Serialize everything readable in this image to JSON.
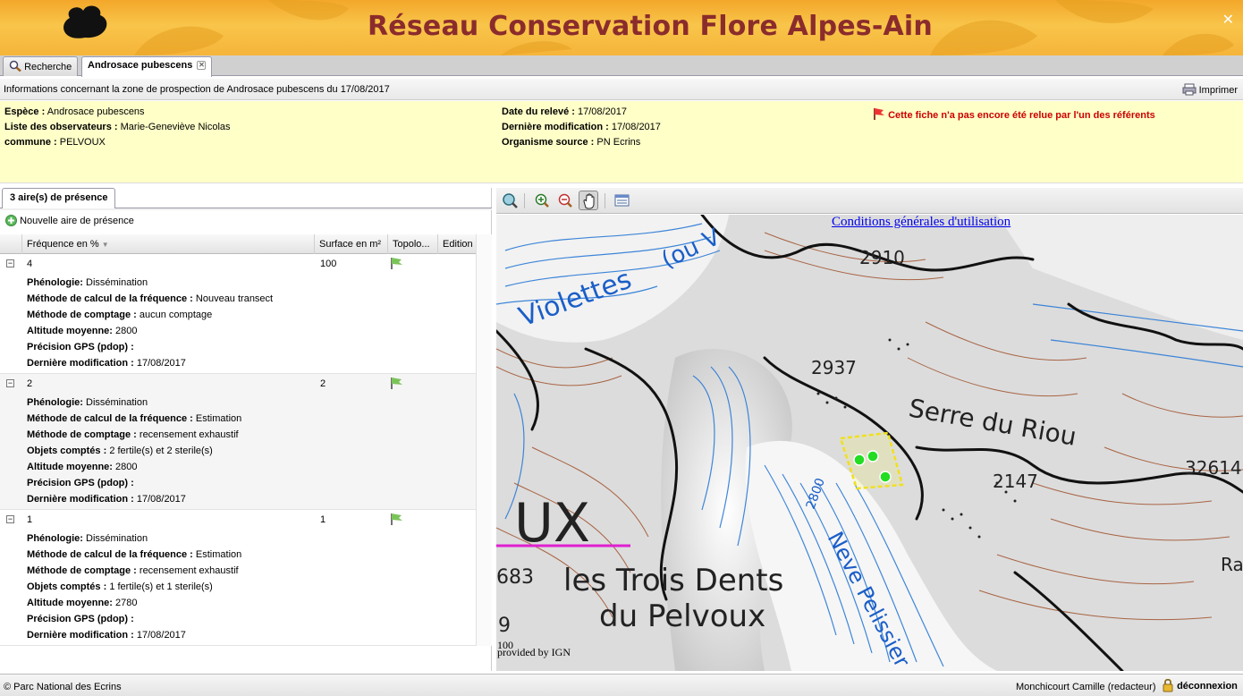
{
  "header": {
    "title": "Réseau Conservation Flore Alpes-Ain",
    "close_glyph": "✕"
  },
  "tabs": [
    {
      "label": "Recherche",
      "icon": "search-icon"
    },
    {
      "label": "Androsace pubescens",
      "closable": true
    }
  ],
  "info_bar": {
    "text": "Informations concernant la zone de prospection de  Androsace pubescens du 17/08/2017",
    "print_label": "Imprimer"
  },
  "details": {
    "espece_label": "Espèce :",
    "espece": "Androsace pubescens",
    "observateurs_label": "Liste des observateurs :",
    "observateurs": "Marie-Geneviève Nicolas",
    "commune_label": "commune :",
    "commune": "PELVOUX",
    "date_label": "Date du relevé :",
    "date": "17/08/2017",
    "modif_label": "Dernière modification :",
    "modif": "17/08/2017",
    "organisme_label": "Organisme source :",
    "organisme": "PN Ecrins",
    "warning": "Cette fiche n'a pas encore été relue par l'un des référents"
  },
  "presence": {
    "tab_label": "3 aire(s) de présence",
    "new_label": "Nouvelle aire de présence",
    "columns": [
      "Fréquence en %",
      "Surface en m²",
      "Topolo...",
      "Edition"
    ],
    "rows": [
      {
        "frequence": "4",
        "surface": "100",
        "details": [
          {
            "label": "Phénologie:",
            "value": "Dissémination"
          },
          {
            "label": "Méthode de calcul de la fréquence :",
            "value": "Nouveau transect"
          },
          {
            "label": "Méthode de comptage :",
            "value": "aucun comptage"
          },
          {
            "label": "Altitude moyenne:",
            "value": "2800"
          },
          {
            "label": "Précision GPS (pdop) :",
            "value": ""
          },
          {
            "label": "Dernière modification :",
            "value": "17/08/2017"
          }
        ]
      },
      {
        "frequence": "2",
        "surface": "2",
        "details": [
          {
            "label": "Phénologie:",
            "value": "Dissémination"
          },
          {
            "label": "Méthode de calcul de la fréquence :",
            "value": "Estimation"
          },
          {
            "label": "Méthode de comptage :",
            "value": "recensement exhaustif"
          },
          {
            "label": "Objets comptés :",
            "value": "2 fertile(s) et 2 sterile(s)"
          },
          {
            "label": "Altitude moyenne:",
            "value": "2800"
          },
          {
            "label": "Précision GPS (pdop) :",
            "value": ""
          },
          {
            "label": "Dernière modification :",
            "value": "17/08/2017"
          }
        ]
      },
      {
        "frequence": "1",
        "surface": "1",
        "details": [
          {
            "label": "Phénologie:",
            "value": "Dissémination"
          },
          {
            "label": "Méthode de calcul de la fréquence :",
            "value": "Estimation"
          },
          {
            "label": "Méthode de comptage :",
            "value": "recensement exhaustif"
          },
          {
            "label": "Objets comptés :",
            "value": "1 fertile(s) et 1 sterile(s)"
          },
          {
            "label": "Altitude moyenne:",
            "value": "2780"
          },
          {
            "label": "Précision GPS (pdop) :",
            "value": ""
          },
          {
            "label": "Dernière modification :",
            "value": "17/08/2017"
          }
        ]
      }
    ]
  },
  "map": {
    "cgu_link": "Conditions générales d'utilisation",
    "labels": [
      "Violettes",
      "(ou V",
      "2910",
      "2937",
      "Serre du Riou",
      "2800",
      "Neve Pelissier",
      "UX",
      "les Trois Dents",
      "du Pelvoux",
      "683",
      "9",
      "2147",
      "32614",
      "Ra"
    ],
    "scale": "100",
    "provider": "provided by IGN"
  },
  "footer": {
    "copyright": "© Parc National des Ecrins",
    "user": "Monchicourt Camille (redacteur)",
    "logout": "déconnexion"
  }
}
